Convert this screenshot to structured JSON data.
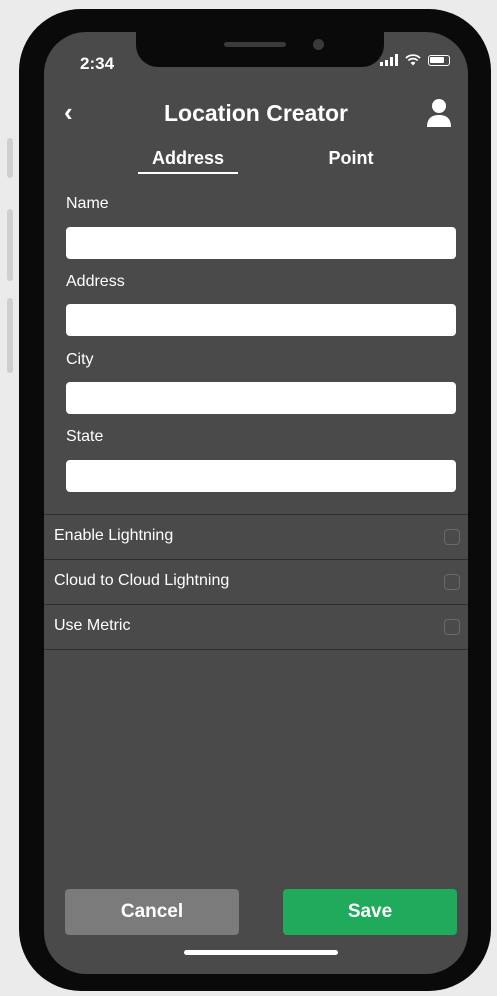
{
  "status_bar": {
    "time": "2:34"
  },
  "header": {
    "title": "Location Creator",
    "back_label": "‹"
  },
  "tabs": [
    {
      "label": "Address",
      "selected": true
    },
    {
      "label": "Point",
      "selected": false
    }
  ],
  "form": {
    "fields": [
      {
        "label": "Name",
        "value": "",
        "placeholder": ""
      },
      {
        "label": "Address",
        "value": "",
        "placeholder": ""
      },
      {
        "label": "City",
        "value": "",
        "placeholder": ""
      },
      {
        "label": "State",
        "value": "",
        "placeholder": ""
      }
    ]
  },
  "options": [
    {
      "label": "Enable Lightning",
      "checked": false
    },
    {
      "label": "Cloud to Cloud Lightning",
      "checked": false
    },
    {
      "label": "Use Metric",
      "checked": false
    }
  ],
  "actions": {
    "cancel_label": "Cancel",
    "save_label": "Save"
  },
  "colors": {
    "background": "#4a4a4a",
    "save": "#1faa5c",
    "cancel": "#7b7b7b"
  }
}
